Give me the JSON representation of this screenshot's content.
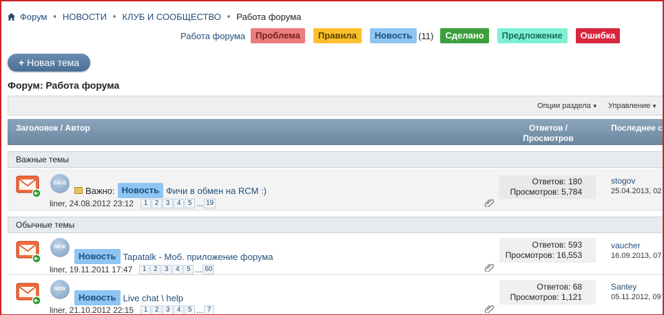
{
  "breadcrumb": {
    "items": [
      "Форум",
      "НОВОСТИ",
      "КЛУБ И СООБЩЕСТВО"
    ],
    "current": "Работа форума"
  },
  "prefixes": {
    "forum_label": "Работа форума",
    "problem": "Проблема",
    "rules": "Правила",
    "news": "Новость",
    "news_count": "(11)",
    "done": "Сделано",
    "proposal": "Предложение",
    "error": "Ошибка",
    "colors": {
      "problem": "#ea7d7d",
      "rules": "#fbc02d",
      "news": "#8ec5f2",
      "done": "#3c9f3c",
      "proposal": "#7ff0d3",
      "error": "#d8263c"
    }
  },
  "new_topic_button": "Новая тема",
  "forum_title": "Форум: Работа форума",
  "options": {
    "section_options": "Опции раздела",
    "manage": "Управление"
  },
  "columns": {
    "title_author": "Заголовок / Автор",
    "replies_views": "Ответов / Просмотров",
    "last": "Последнее с"
  },
  "sections": {
    "sticky": "Важные темы",
    "normal": "Обычные темы"
  },
  "threads": [
    {
      "badge": "SALE",
      "important_label": "Важно:",
      "prefix": "Новость",
      "title": "Фичи в обмен на RCM :)",
      "author_date": "liner, 24.08.2012 23:12",
      "pages": [
        "1",
        "2",
        "3",
        "4",
        "5"
      ],
      "last_page": "19",
      "ellipsis": "...",
      "replies": "Ответов: 180",
      "views": "Просмотров: 5,784",
      "last_user": "stogov",
      "last_date": "25.04.2013, 02"
    },
    {
      "badge": "NEW",
      "prefix": "Новость",
      "title": "Tapatalk - Моб. приложение форума",
      "author_date": "liner, 19.11.2011 17:47",
      "pages": [
        "1",
        "2",
        "3",
        "4",
        "5"
      ],
      "last_page": "60",
      "ellipsis": "...",
      "replies": "Ответов: 593",
      "views": "Просмотров: 16,553",
      "last_user": "vaucher",
      "last_date": "16.09.2013, 07"
    },
    {
      "badge": "NEW",
      "prefix": "Новость",
      "title": "Live chat \\ help",
      "author_date": "liner, 21.10.2012 22:15",
      "pages": [
        "1",
        "2",
        "3",
        "4",
        "5"
      ],
      "last_page": "7",
      "ellipsis": "...",
      "replies": "Ответов: 68",
      "views": "Просмотров: 1,121",
      "last_user": "Santey",
      "last_date": "05.11.2012, 09"
    }
  ]
}
